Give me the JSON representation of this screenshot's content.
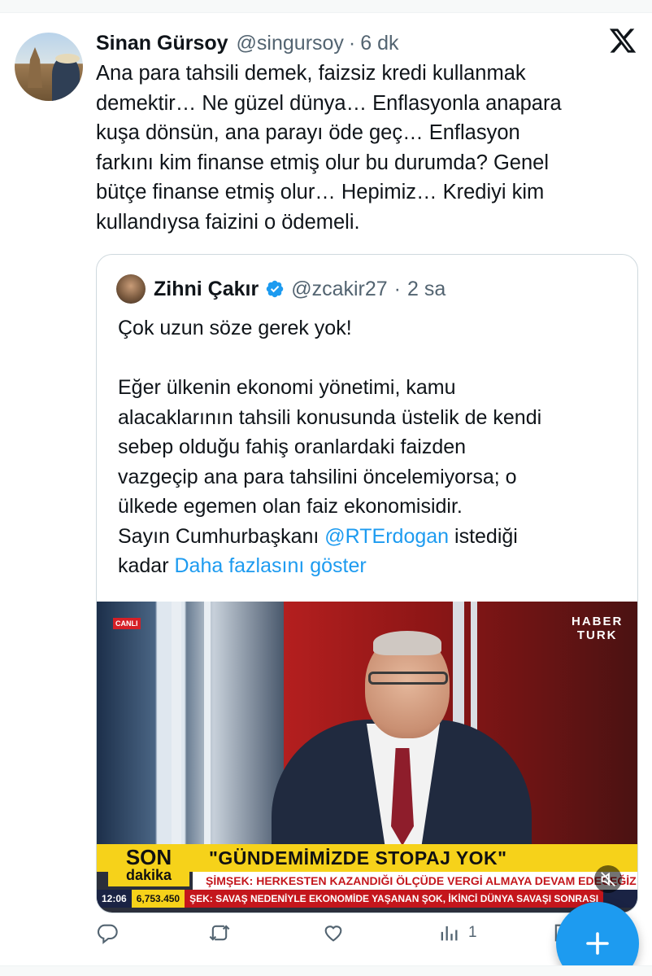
{
  "tweet": {
    "author_name": "Sinan Gürsoy",
    "author_handle": "@singursoy",
    "separator": "·",
    "time": "6 dk",
    "text_lines": [
      "Ana para tahsili demek, faizsiz kredi kullanmak",
      "demektir… Ne güzel dünya… Enflasyonla anapara",
      "kuşa dönsün, ana parayı öde geç… Enflasyon",
      "farkını kim finanse etmiş olur bu durumda? Genel",
      "bütçe finanse etmiş olur… Hepimiz… Krediyi kim",
      "kullandıysa faizini o ödemeli."
    ]
  },
  "quote": {
    "author_name": "Zihni Çakır",
    "author_handle": "@zcakir27",
    "separator": "·",
    "time": "2 sa",
    "text_lines": [
      "Çok uzun söze gerek yok!",
      "",
      "Eğer ülkenin ekonomi yönetimi, kamu",
      "alacaklarının tahsili konusunda üstelik de kendi",
      "sebep olduğu fahiş oranlardaki faizden",
      "vazgeçip ana para tahsilini öncelemiyorsa; o",
      "ülkede egemen olan faiz ekonomisidir."
    ],
    "line_mention_prefix": "Sayın Cumhurbaşkanı ",
    "mention": "@RTErdogan",
    "line_mention_suffix": " istediği",
    "last_line_prefix": "kadar ",
    "show_more": "Daha fazlasını göster"
  },
  "media": {
    "live_badge": "CANLI",
    "channel_logo_line1": "HABER",
    "channel_logo_line2": "TURK",
    "son": "SON",
    "dakika": "dakika",
    "headline": "\"GÜNDEMİMİZDE STOPAJ YOK\"",
    "sub_headline": "ŞİMŞEK: HERKESTEN KAZANDIĞI ÖLÇÜDE VERGİ ALMAYA DEVAM EDECEĞİZ",
    "clock": "12:06",
    "bist": "6,753.450",
    "ticker": "ŞEK: SAVAŞ NEDENİYLE EKONOMİDE YAŞANAN ŞOK, İKİNCİ DÜNYA SAVAŞI SONRASI"
  },
  "actions": {
    "reply_icon": "reply-icon",
    "retweet_icon": "retweet-icon",
    "like_icon": "heart-icon",
    "views_icon": "views-icon",
    "views_count": "1",
    "compose_icon": "plus-icon"
  },
  "colors": {
    "accent": "#1d9bf0",
    "text": "#0f1419",
    "secondary": "#536471",
    "border": "#cfd9de"
  }
}
